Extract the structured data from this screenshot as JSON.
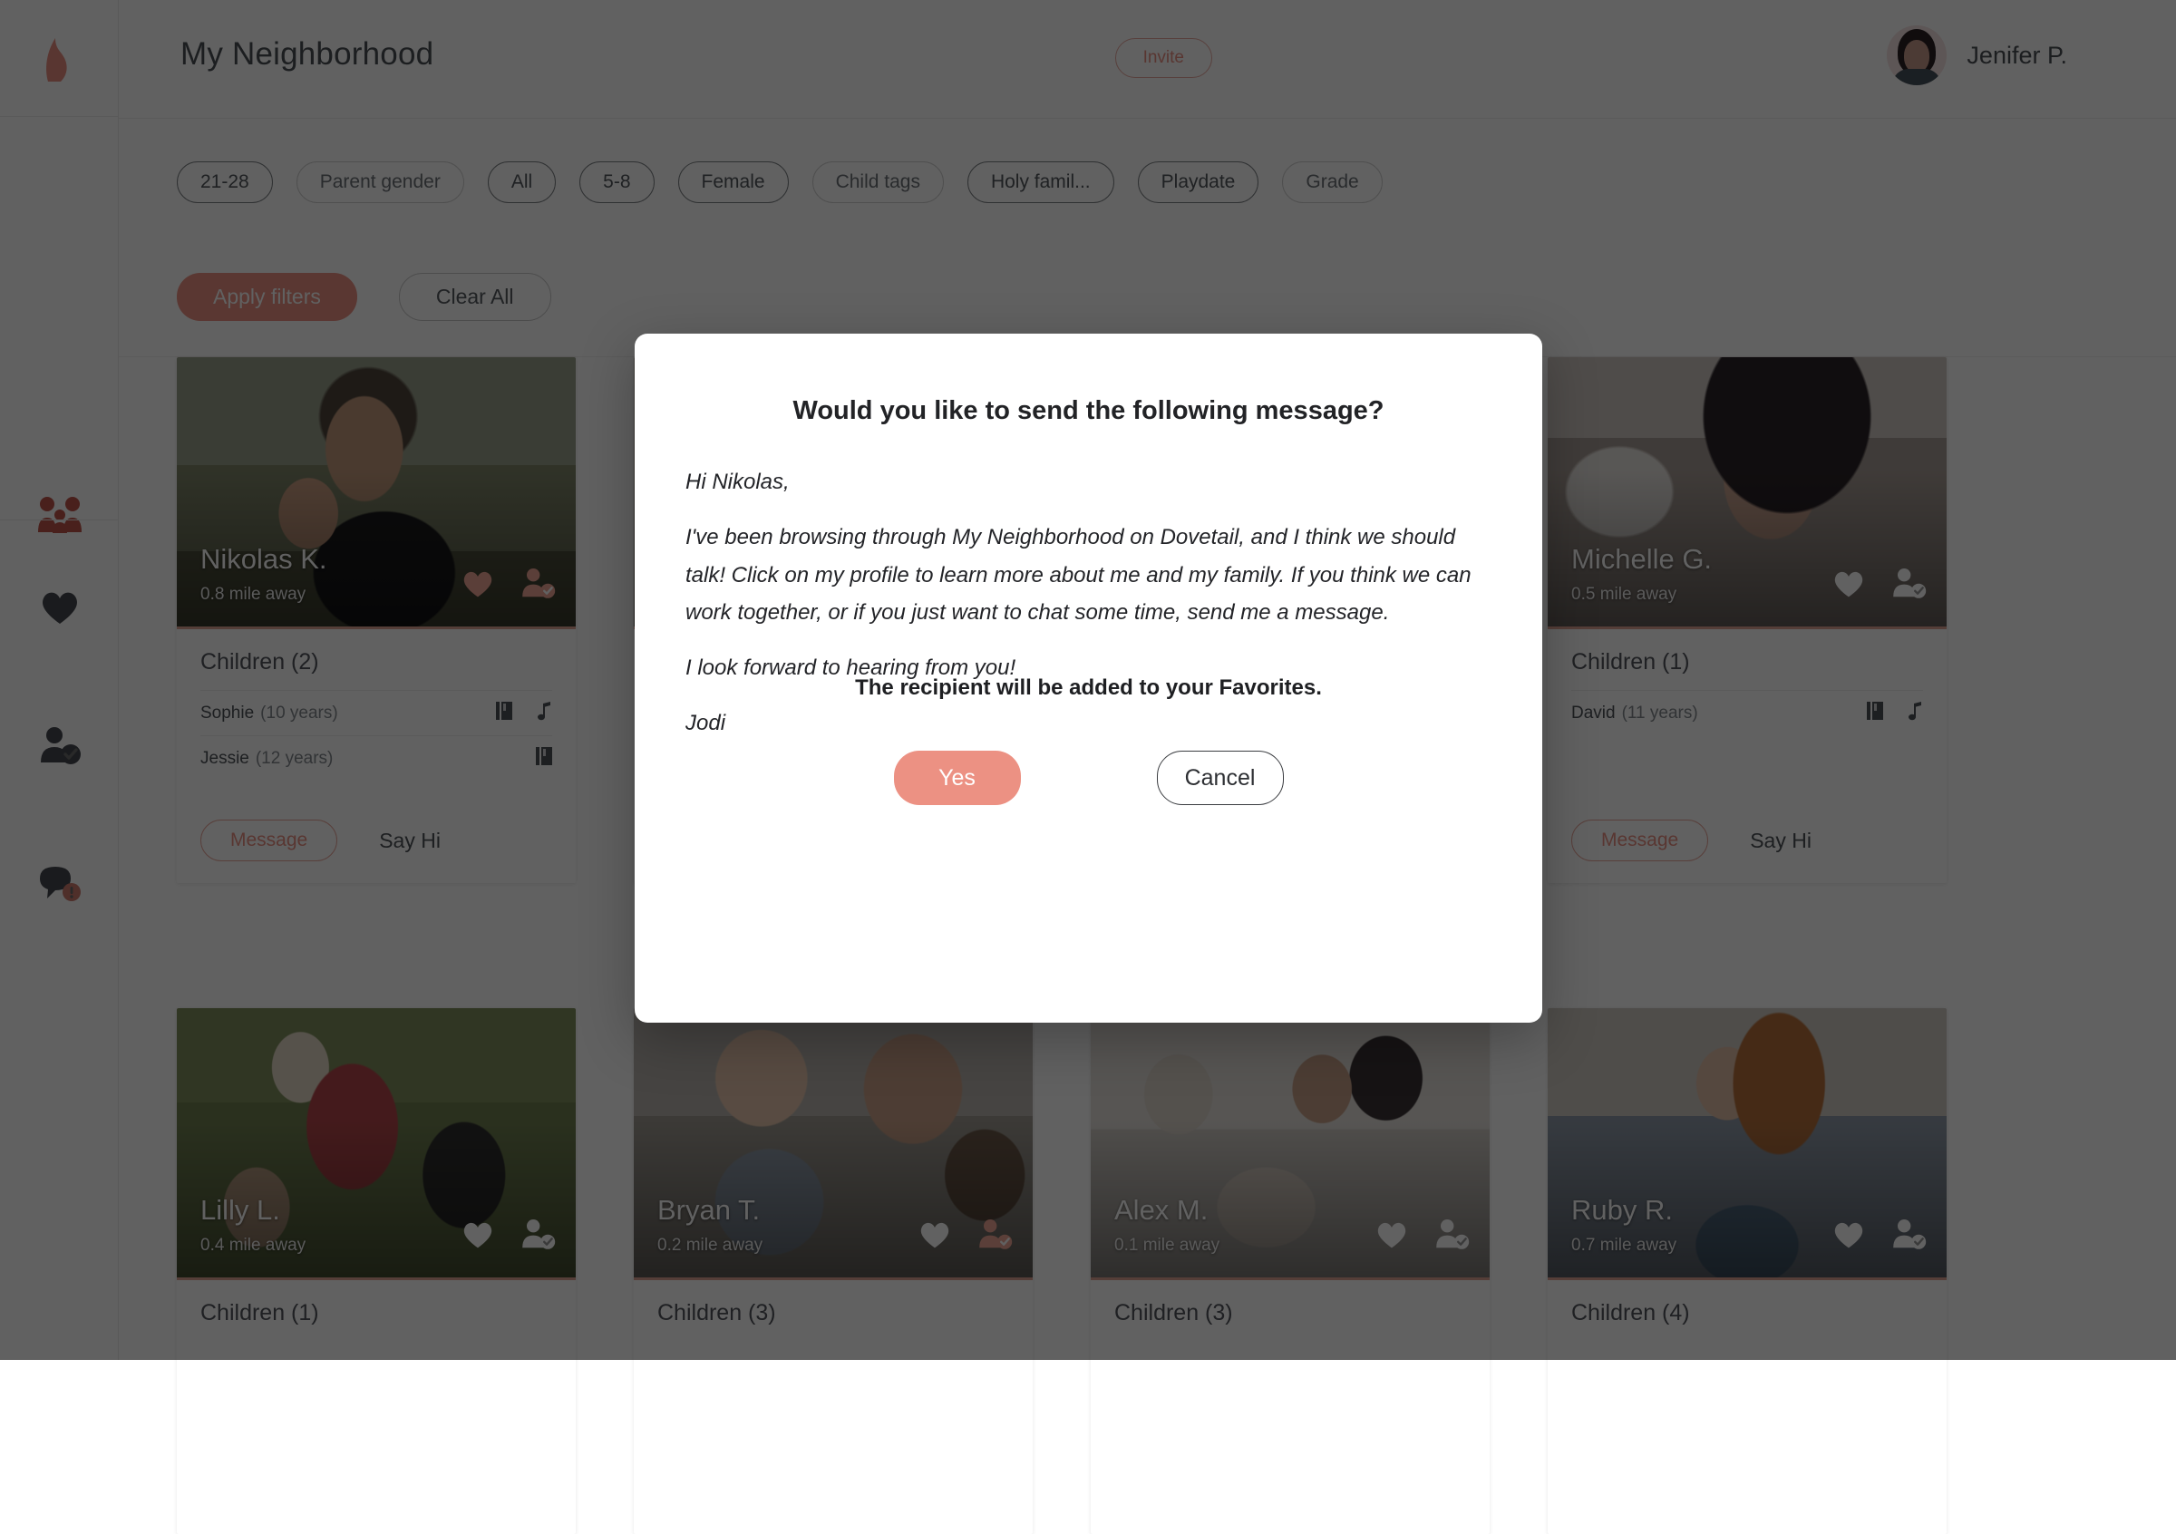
{
  "brand": {
    "logo_icon": "flame-logo-icon",
    "accent": "#ec9183"
  },
  "header": {
    "title": "My Neighborhood",
    "invite_label": "Invite",
    "user_name": "Jenifer P.",
    "avatar_icon": "user-avatar"
  },
  "sidebar": {
    "items": [
      {
        "icon": "family-group-icon",
        "active": true
      },
      {
        "icon": "heart-icon",
        "active": false
      },
      {
        "icon": "user-verified-icon",
        "active": false
      },
      {
        "icon": "chat-bubble-icon",
        "active": false,
        "badge": "1"
      }
    ]
  },
  "filters": {
    "chips": [
      {
        "label": "21-28",
        "selected": true
      },
      {
        "label": "Parent gender",
        "selected": false
      },
      {
        "label": "All",
        "selected": true
      },
      {
        "label": "5-8",
        "selected": true
      },
      {
        "label": "Female",
        "selected": true
      },
      {
        "label": "Child tags",
        "selected": false
      },
      {
        "label": "Holy famil...",
        "selected": true
      },
      {
        "label": "Playdate",
        "selected": true
      },
      {
        "label": "Grade",
        "selected": false
      }
    ],
    "apply_label": "Apply filters",
    "clear_label": "Clear All"
  },
  "cards": [
    {
      "name": "Nikolas K.",
      "distance": "0.8 mile away",
      "children_title": "Children (2)",
      "children": [
        {
          "name": "Sophie",
          "age": "(10 years)",
          "tags": [
            "book-icon",
            "music-note-icon"
          ]
        },
        {
          "name": "Jessie",
          "age": "(12 years)",
          "tags": [
            "book-icon"
          ]
        }
      ],
      "message_label": "Message",
      "sayhi_label": "Say Hi",
      "favorite_icon": "heart-icon",
      "favorite_active": true,
      "connect_icon": "user-verified-icon",
      "photo": "father-daughter-field"
    },
    {
      "name": "Michelle G.",
      "distance": "0.5 mile away",
      "children_title": "Children (1)",
      "children": [
        {
          "name": "David",
          "age": "(11 years)",
          "tags": [
            "book-icon",
            "music-note-icon"
          ]
        }
      ],
      "message_label": "Message",
      "sayhi_label": "Say Hi",
      "favorite_icon": "heart-icon",
      "favorite_active": false,
      "connect_icon": "user-verified-icon",
      "photo": "woman-portrait"
    },
    {
      "name": "Lilly L.",
      "distance": "0.4 mile away",
      "children_title": "Children (1)",
      "children": [],
      "message_label": "Message",
      "sayhi_label": "Say Hi",
      "favorite_icon": "heart-icon",
      "favorite_active": false,
      "connect_icon": "user-verified-icon",
      "photo": "mother-children-grass"
    },
    {
      "name": "Bryan T.",
      "distance": "0.2 mile away",
      "children_title": "Children (3)",
      "children": [],
      "message_label": "Message",
      "sayhi_label": "Say Hi",
      "favorite_icon": "heart-icon",
      "favorite_active": false,
      "connect_icon": "user-verified-icon",
      "photo": "baby-father"
    },
    {
      "name": "Alex M.",
      "distance": "0.1 mile away",
      "children_title": "Children (3)",
      "children": [],
      "message_label": "Message",
      "sayhi_label": "Say Hi",
      "favorite_icon": "heart-icon",
      "favorite_active": false,
      "connect_icon": "user-verified-icon",
      "photo": "family-bed"
    },
    {
      "name": "Ruby R.",
      "distance": "0.7 mile away",
      "children_title": "Children (4)",
      "children": [],
      "message_label": "Message",
      "sayhi_label": "Say Hi",
      "favorite_icon": "heart-icon",
      "favorite_active": false,
      "connect_icon": "user-verified-icon",
      "photo": "redhead-portrait"
    }
  ],
  "modal": {
    "title": "Would you like to send the following message?",
    "greeting": "Hi Nikolas,",
    "paragraph": "I've been browsing through My Neighborhood on Dovetail, and I think we should talk! Click on my profile to learn more about me and my family. If you think we can work together, or if you just want to chat some time, send me a message.",
    "closing": "I look forward to hearing from you!",
    "signature": "Jodi",
    "note": "The recipient will be added to your Favorites.",
    "yes_label": "Yes",
    "cancel_label": "Cancel"
  }
}
